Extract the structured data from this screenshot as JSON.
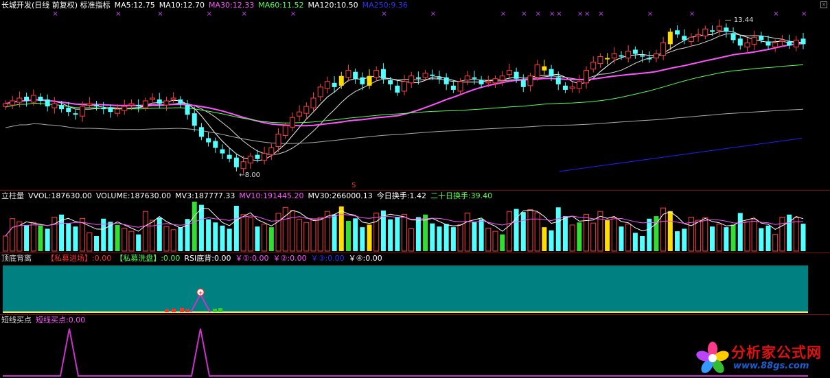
{
  "colors": {
    "up": "#ff4040",
    "down": "#54ffff",
    "ma5": "#ffffff",
    "ma10": "#ffff54",
    "ma30": "#ff54ff",
    "ma60": "#54ff54",
    "ma120": "#aaaaaa",
    "ma250": "#2020ff",
    "teal": "#008080",
    "magenta": "#cc33cc"
  },
  "main": {
    "title": "长城开发(日线 前复权) 标准指标",
    "ma_labels": [
      {
        "text": "MA5:12.75",
        "color": "#ffffff"
      },
      {
        "text": "MA10:12.70",
        "color": "#ffffff"
      },
      {
        "text": "MA30:12.33",
        "color": "#ff54ff"
      },
      {
        "text": "MA60:11.52",
        "color": "#54ff54"
      },
      {
        "text": "MA120:10.50",
        "color": "#ffffff"
      },
      {
        "text": "MA250:9.36",
        "color": "#3030ff"
      }
    ],
    "high_label": "13.44",
    "low_label": "8.00",
    "s_marker": "S"
  },
  "volume": {
    "title": "立柱量",
    "labels": [
      {
        "text": "VVOL:187630.00",
        "color": "#ffffff"
      },
      {
        "text": "VOLUME:187630.00",
        "color": "#ffffff"
      },
      {
        "text": "MV3:187777.33",
        "color": "#ffffff"
      },
      {
        "text": "MV10:191445.20",
        "color": "#ff54ff"
      },
      {
        "text": "MV30:266000.13",
        "color": "#ffffff"
      },
      {
        "text": "今日换手:1.42",
        "color": "#ffffff"
      },
      {
        "text": "二十日换手:39.40",
        "color": "#54ff54"
      }
    ]
  },
  "divergence": {
    "title": "顶底背离",
    "labels": [
      {
        "text": "【私募进场】:0.00",
        "color": "#ff3030"
      },
      {
        "text": "【私募洗盘】:0.00",
        "color": "#54ff54"
      },
      {
        "text": "RSI底背:0.00",
        "color": "#ffffff"
      },
      {
        "text": "￥①:0.00",
        "color": "#ff54ff"
      },
      {
        "text": "￥②:0.00",
        "color": "#ff54ff"
      },
      {
        "text": "￥③:0.00",
        "color": "#3030ff"
      },
      {
        "text": "￥④:0.00",
        "color": "#ffffff"
      }
    ]
  },
  "short_buy": {
    "title": "短线买点",
    "labels": [
      {
        "text": "短线买点:0.00",
        "color": "#ff54ff"
      }
    ]
  },
  "logo": {
    "name": "分析家公式网",
    "url": "www.88gs.com"
  },
  "chart_data": [
    {
      "type": "candlestick",
      "title": "长城开发(日线 前复权) 标准指标",
      "x": "trading days (oldest→newest)",
      "ylim": [
        7.6,
        14.0
      ],
      "closes": [
        10.6,
        10.7,
        10.8,
        10.7,
        10.9,
        10.7,
        10.5,
        10.6,
        10.4,
        10.3,
        10.2,
        10.5,
        10.6,
        10.5,
        10.4,
        10.3,
        10.4,
        10.5,
        10.6,
        10.5,
        10.7,
        10.8,
        10.6,
        10.7,
        10.8,
        10.6,
        10.2,
        9.8,
        9.4,
        9.2,
        9.0,
        8.8,
        8.6,
        8.3,
        8.5,
        8.7,
        8.6,
        8.8,
        9.0,
        9.5,
        9.8,
        10.1,
        10.3,
        10.5,
        10.8,
        11.2,
        11.4,
        11.2,
        11.6,
        11.8,
        11.5,
        11.3,
        11.6,
        11.8,
        11.5,
        11.3,
        11.0,
        11.4,
        11.6,
        11.5,
        11.7,
        11.6,
        11.5,
        11.3,
        11.1,
        11.4,
        11.6,
        11.5,
        11.3,
        11.4,
        11.5,
        11.6,
        11.8,
        11.5,
        11.2,
        11.6,
        12.0,
        11.8,
        11.6,
        11.3,
        11.1,
        11.2,
        11.4,
        11.8,
        12.1,
        12.3,
        12.2,
        12.4,
        12.3,
        12.5,
        12.4,
        12.3,
        12.2,
        12.4,
        12.8,
        13.2,
        13.1,
        12.9,
        13.0,
        13.1,
        13.3,
        13.2,
        13.4,
        13.2,
        12.9,
        12.7,
        12.8,
        13.0,
        12.9,
        12.7,
        12.8,
        12.9,
        12.7,
        12.9,
        12.75
      ]
    },
    {
      "type": "bar",
      "title": "立柱量",
      "series": [
        {
          "name": "VVOL",
          "values": [
            187630.0
          ]
        },
        {
          "name": "MV3",
          "values": [
            187777.33
          ]
        },
        {
          "name": "MV10",
          "values": [
            191445.2
          ]
        },
        {
          "name": "MV30",
          "values": [
            266000.13
          ]
        }
      ]
    },
    {
      "type": "line",
      "title": "短线买点",
      "series": [
        {
          "name": "短线买点",
          "values": [
            0.0
          ]
        }
      ]
    }
  ]
}
